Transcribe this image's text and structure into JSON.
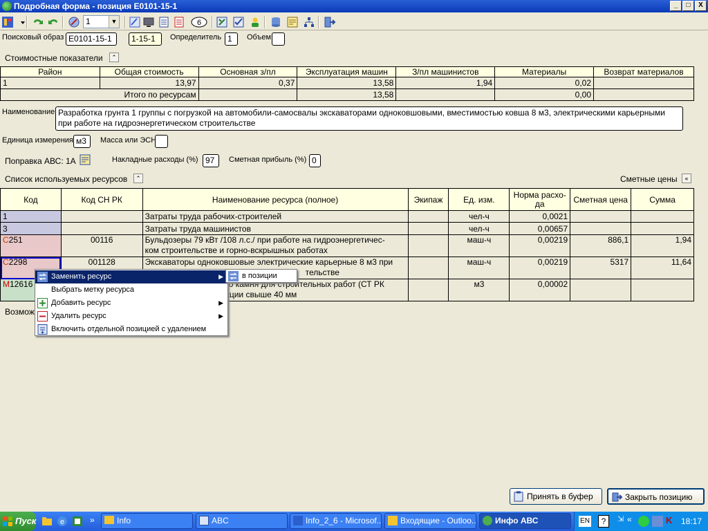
{
  "window": {
    "title": "Подробная форма - позиция E0101-15-1",
    "btn_min": "_",
    "btn_max": "□",
    "btn_close": "X"
  },
  "toolbar": {
    "combo_value": "1",
    "circle_value": "6"
  },
  "search": {
    "label": "Поисковый образ",
    "code_value": "E0101-15-1",
    "code2_value": "1-15-1",
    "determinant_label": "Определитель",
    "determinant_value": "1",
    "volume_label": "Объем",
    "volume_value": ""
  },
  "cost": {
    "section_label": "Стоимостные показатели",
    "headers": [
      "Район",
      "Общая стоимость",
      "Основная з/пл",
      "Эксплуатация машин",
      "З/пл машинистов",
      "Материалы",
      "Возврат материалов"
    ],
    "row": [
      "1",
      "13,97",
      "0,37",
      "13,58",
      "1,94",
      "0,02",
      ""
    ],
    "total_label": "Итого по ресурсам",
    "total_values": [
      "13,58",
      "0,00"
    ]
  },
  "name": {
    "label": "Наименование",
    "line1": "Разработка грунта 1 группы с погрузкой на автомобили-самосвалы экскаваторами одноковшовыми, вместимостью ковша 8 м3, электрическими карьерными",
    "line2": "при работе на гидроэнергетическом строительстве"
  },
  "unit": {
    "label": "Единица измерения",
    "value": "м3",
    "mass_label": "Масса или ЭСН",
    "mass_value": ""
  },
  "correction": {
    "label": "Поправка АВС: 1А",
    "overhead_label": "Накладные расходы (%)",
    "overhead_value": "97",
    "profit_label": "Сметная прибыль (%)",
    "profit_value": "0"
  },
  "resources": {
    "section_label": "Список используемых ресурсов",
    "prices_label": "Сметные цены",
    "headers": [
      "Код",
      "Код СН РК",
      "Наименование ресурса (полное)",
      "Экипаж",
      "Ед. изм.",
      "Норма расхо-\nда",
      "Сметная цена",
      "Сумма"
    ],
    "rows": [
      {
        "code_prefix": "",
        "code": "1",
        "cn": "",
        "name1": "Затраты труда рабочих-строителей",
        "name2": "",
        "crew": "",
        "unit": "чел-ч",
        "norm": "0,0021",
        "price": "",
        "sum": ""
      },
      {
        "code_prefix": "",
        "code": "3",
        "cn": "",
        "name1": "Затраты труда машинистов",
        "name2": "",
        "crew": "",
        "unit": "чел-ч",
        "norm": "0,00657",
        "price": "",
        "sum": ""
      },
      {
        "code_prefix": "С",
        "code": "251",
        "cn": "00116",
        "name1": "Бульдозеры 79 кВт /108 л.с./ при работе на гидроэнергетичес-",
        "name2": "ком строительстве и горно-вскрышных работах",
        "crew": "",
        "unit": "маш-ч",
        "norm": "0,00219",
        "price": "886,1",
        "sum": "1,94"
      },
      {
        "code_prefix": "С",
        "code": "2298",
        "cn": "001128",
        "name1": "Экскаваторы одноковшовые электрические карьерные 8 м3 при",
        "name2": "тельстве",
        "crew": "",
        "unit": "маш-ч",
        "norm": "0,00219",
        "price": "5317",
        "sum": "11,64"
      },
      {
        "code_prefix": "М",
        "code": "12616",
        "cn": "",
        "name1": "го камня для строительных работ (СТ РК",
        "name2": "кции свыше 40 мм",
        "crew": "",
        "unit": "м3",
        "norm": "0,00002",
        "price": "",
        "sum": ""
      }
    ],
    "partial_label": "Возмож"
  },
  "context_menu": {
    "items": [
      "Заменить ресурс",
      "Выбрать метку ресурса",
      "Добавить ресурс",
      "Удалить ресурс",
      "Включить отдельной позицией с удалением"
    ],
    "submenu_item": "в позиции"
  },
  "buttons": {
    "accept": "Принять в буфер",
    "close": "Закрыть позицию"
  },
  "taskbar": {
    "start": "Пуск",
    "chevron": "»",
    "tasks": [
      "Info",
      "ABC",
      "Info_2_6 - Microsof...",
      "Входящие - Outloo...",
      "Инфо АВС"
    ],
    "lang": "EN",
    "clock": "18:17"
  },
  "colors": {
    "header_bg": "#ffffe1",
    "row_labor": "#c8c8e0",
    "row_machine": "#e8c8c8",
    "row_material": "#c8e0c8",
    "accent": "#0a246a"
  }
}
